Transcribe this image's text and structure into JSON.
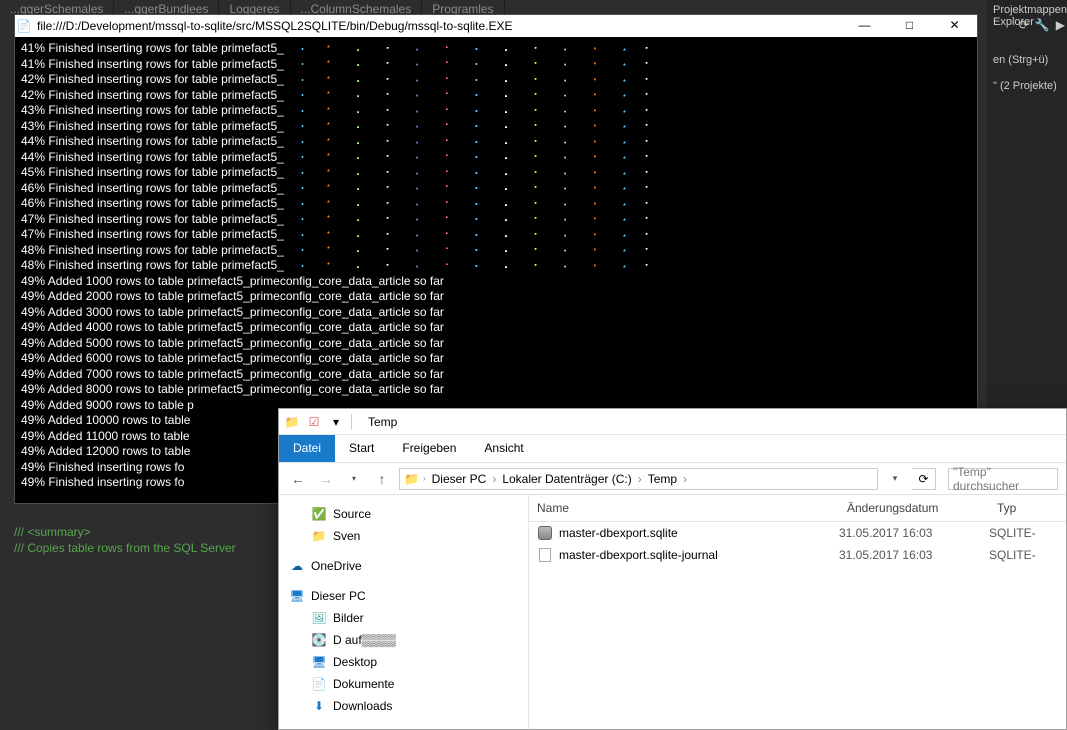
{
  "vs": {
    "top_tabs": [
      "...ggerSchemales",
      "...ggerBundlees",
      "Loggeres",
      "...ColumnSchemales",
      "Programles"
    ],
    "right_header": "Projektmappen-Explorer",
    "right_hint": "en (Strg+ü)",
    "right_proj": "\" (2 Projekte)",
    "toolbar_icons": [
      "⟳",
      "🔧",
      "▶"
    ]
  },
  "code": {
    "line1": "/// <summary>",
    "line2": "///     Copies table rows from the SQL Server"
  },
  "console": {
    "icon": "📄",
    "title": "file:///D:/Development/mssql-to-sqlite/src/MSSQL2SQLITE/bin/Debug/mssql-to-sqlite.EXE",
    "min": "—",
    "max": "□",
    "close": "✕",
    "lines": [
      {
        "p": "41%",
        "t": "Finished inserting rows for table primefact5_",
        "noise": true
      },
      {
        "p": "41%",
        "t": "Finished inserting rows for table primefact5_",
        "noise": true
      },
      {
        "p": "42%",
        "t": "Finished inserting rows for table primefact5_",
        "noise": true
      },
      {
        "p": "42%",
        "t": "Finished inserting rows for table primefact5_",
        "noise": true
      },
      {
        "p": "43%",
        "t": "Finished inserting rows for table primefact5_",
        "noise": true
      },
      {
        "p": "43%",
        "t": "Finished inserting rows for table primefact5_",
        "noise": true
      },
      {
        "p": "44%",
        "t": "Finished inserting rows for table primefact5_",
        "noise": true
      },
      {
        "p": "44%",
        "t": "Finished inserting rows for table primefact5_",
        "noise": true
      },
      {
        "p": "45%",
        "t": "Finished inserting rows for table primefact5_",
        "noise": true
      },
      {
        "p": "46%",
        "t": "Finished inserting rows for table primefact5_",
        "noise": true
      },
      {
        "p": "46%",
        "t": "Finished inserting rows for table primefact5_",
        "noise": true
      },
      {
        "p": "47%",
        "t": "Finished inserting rows for table primefact5_",
        "noise": true
      },
      {
        "p": "47%",
        "t": "Finished inserting rows for table primefact5_",
        "noise": true
      },
      {
        "p": "48%",
        "t": "Finished inserting rows for table primefact5_",
        "noise": true
      },
      {
        "p": "48%",
        "t": "Finished inserting rows for table primefact5_",
        "noise": true
      },
      {
        "p": "49%",
        "t": "Added 1000 rows to table primefact5_primeconfig_core_data_article so far",
        "noise": false
      },
      {
        "p": "49%",
        "t": "Added 2000 rows to table primefact5_primeconfig_core_data_article so far",
        "noise": false
      },
      {
        "p": "49%",
        "t": "Added 3000 rows to table primefact5_primeconfig_core_data_article so far",
        "noise": false
      },
      {
        "p": "49%",
        "t": "Added 4000 rows to table primefact5_primeconfig_core_data_article so far",
        "noise": false
      },
      {
        "p": "49%",
        "t": "Added 5000 rows to table primefact5_primeconfig_core_data_article so far",
        "noise": false
      },
      {
        "p": "49%",
        "t": "Added 6000 rows to table primefact5_primeconfig_core_data_article so far",
        "noise": false
      },
      {
        "p": "49%",
        "t": "Added 7000 rows to table primefact5_primeconfig_core_data_article so far",
        "noise": false
      },
      {
        "p": "49%",
        "t": "Added 8000 rows to table primefact5_primeconfig_core_data_article so far",
        "noise": false
      },
      {
        "p": "49%",
        "t": "Added 9000 rows to table p",
        "noise": false
      },
      {
        "p": "49%",
        "t": "Added 10000 rows to table",
        "noise": false
      },
      {
        "p": "49%",
        "t": "Added 11000 rows to table",
        "noise": false
      },
      {
        "p": "49%",
        "t": "Added 12000 rows to table",
        "noise": false
      },
      {
        "p": "49%",
        "t": "Finished inserting rows fo",
        "noise": false
      },
      {
        "p": "49%",
        "t": "Finished inserting rows fo",
        "noise": false
      }
    ]
  },
  "explorer": {
    "qat": {
      "folder": "📁",
      "props": "☑",
      "save": "▾",
      "title": "Temp"
    },
    "ribbon": {
      "file": "Datei",
      "start": "Start",
      "share": "Freigeben",
      "view": "Ansicht"
    },
    "nav": {
      "back": "←",
      "fwd": "→",
      "recent": "▾",
      "up": "↑",
      "refresh": "⟳",
      "dropdown": "▾"
    },
    "breadcrumbs": [
      "Dieser PC",
      "Lokaler Datenträger (C:)",
      "Temp"
    ],
    "search_placeholder": "\"Temp\" durchsucher",
    "columns": {
      "name": "Name",
      "date": "Änderungsdatum",
      "type": "Typ"
    },
    "tree": [
      {
        "icon": "✅",
        "label": "Source",
        "indent": true,
        "color": "#2e7d32"
      },
      {
        "icon": "📁",
        "label": "Sven",
        "indent": true,
        "color": "#f0c04a"
      },
      {
        "icon": "",
        "label": "",
        "indent": false,
        "spacer": true
      },
      {
        "icon": "☁",
        "label": "OneDrive",
        "indent": false,
        "color": "#0a64a4"
      },
      {
        "icon": "",
        "label": "",
        "indent": false,
        "spacer": true
      },
      {
        "icon": "🖥",
        "label": "Dieser PC",
        "indent": false,
        "color": "#1979ca"
      },
      {
        "icon": "🖼",
        "label": "Bilder",
        "indent": true,
        "color": "#4aa"
      },
      {
        "icon": "💽",
        "label": "D auf▒▒▒▒",
        "indent": true,
        "color": "#555"
      },
      {
        "icon": "🖥",
        "label": "Desktop",
        "indent": true,
        "color": "#1979ca"
      },
      {
        "icon": "📄",
        "label": "Dokumente",
        "indent": true,
        "color": "#555"
      },
      {
        "icon": "⬇",
        "label": "Downloads",
        "indent": true,
        "color": "#1979ca"
      }
    ],
    "files": [
      {
        "icon": "db",
        "name": "master-dbexport.sqlite",
        "date": "31.05.2017 16:03",
        "type": "SQLITE-"
      },
      {
        "icon": "doc",
        "name": "master-dbexport.sqlite-journal",
        "date": "31.05.2017 16:03",
        "type": "SQLITE-"
      }
    ]
  }
}
